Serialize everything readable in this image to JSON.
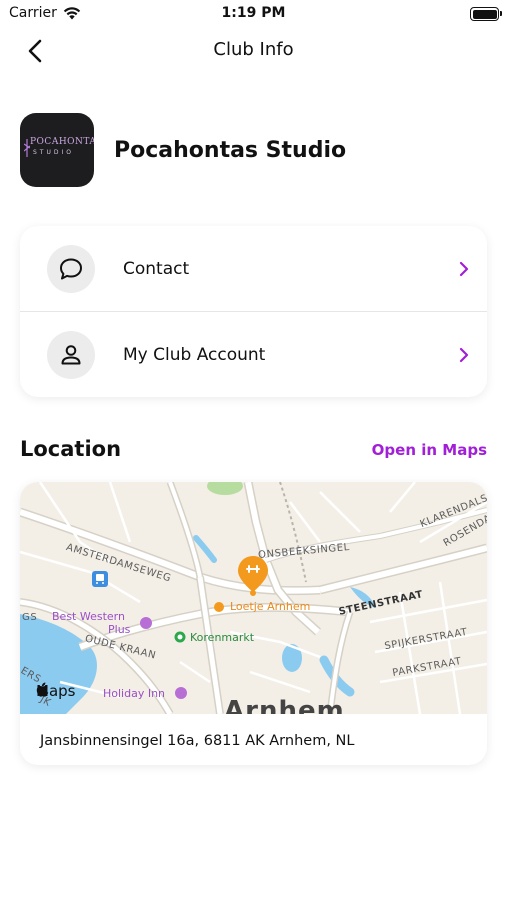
{
  "status_bar": {
    "carrier": "Carrier",
    "time": "1:19 PM"
  },
  "nav": {
    "title": "Club Info"
  },
  "club": {
    "name": "Pocahontas Studio",
    "logo_text_main": "POCAHONTAS",
    "logo_text_sub": "STUDIO"
  },
  "menu": [
    {
      "label": "Contact",
      "icon": "chat-bubble-icon"
    },
    {
      "label": "My Club Account",
      "icon": "person-icon"
    }
  ],
  "location": {
    "title": "Location",
    "open_in_maps": "Open in Maps",
    "address": "Jansbinnensingel 16a, 6811 AK Arnhem, NL"
  },
  "map": {
    "streets": {
      "amsterdamseweg": "AMSTERDAMSEWEG",
      "sonsbeeksingel": "ONSBEEKSINGEL",
      "steenstraat": "STEENSTRAAT",
      "spijkerstraat": "SPIJKERSTRAAT",
      "parkstraat": "PARKSTRAAT",
      "oude_kraan": "OUDE KRAAN",
      "klarendal": "KLARENDALS",
      "rosendaal": "ROSENDAAL",
      "left_edge_1": "GS",
      "left_edge_2": "ERS",
      "left_edge_3": "JK"
    },
    "pois": {
      "best_western_1": "Best Western",
      "best_western_2": "Plus",
      "loetje": "Loetje Arnhem",
      "korenmarkt": "Korenmarkt",
      "holiday_inn": "Holiday Inn"
    },
    "city": "Arnhem",
    "maps_brand": "Maps"
  },
  "colors": {
    "accent": "#a11fd6",
    "pin": "#f39a1e",
    "water": "#8ccbf0",
    "park": "#b7dca0"
  }
}
